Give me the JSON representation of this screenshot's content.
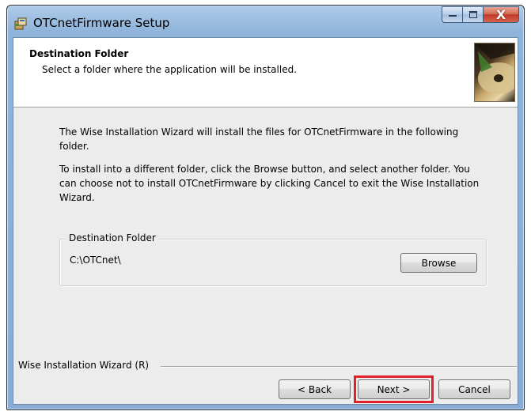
{
  "window": {
    "title": "OTCnetFirmware Setup",
    "icon": "setup-package-icon"
  },
  "caption": {
    "minimize_glyph": "—",
    "maximize_glyph": "☐",
    "close_glyph": "X"
  },
  "banner": {
    "title": "Destination Folder",
    "subtitle": "Select a folder where the application will be installed.",
    "image": "installer-cd-graphic"
  },
  "body": {
    "paragraph1": "The Wise Installation Wizard will install the files for OTCnetFirmware in the following folder.",
    "paragraph2": "To install into a different folder, click the Browse button, and select another folder. You can choose not to install OTCnetFirmware by clicking Cancel to exit the Wise Installation Wizard."
  },
  "destination": {
    "group_label": "Destination Folder",
    "path": "C:\\OTCnet\\",
    "browse_label": "Browse"
  },
  "footer": {
    "brand_label": "Wise Installation Wizard (R)",
    "back_label": "< Back",
    "next_label": "Next >",
    "cancel_label": "Cancel"
  },
  "colors": {
    "highlight": "#e0202a",
    "title_bar": "#9fbfe0",
    "close_button": "#c0392b"
  }
}
